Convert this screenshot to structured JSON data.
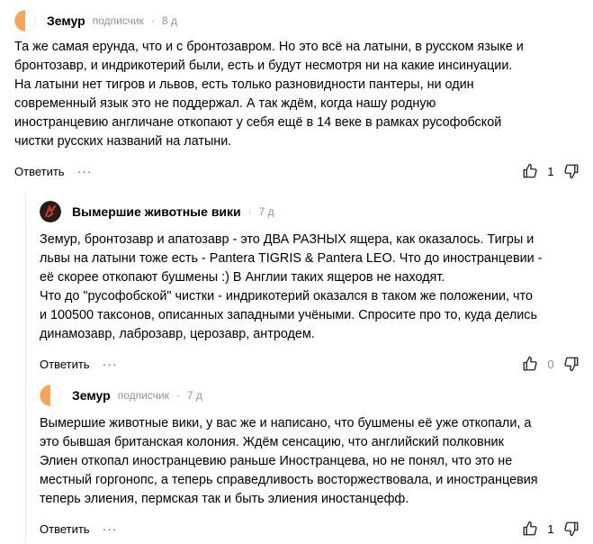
{
  "comments": [
    {
      "author": "Земур",
      "badge": "подписчик",
      "time": "8 д",
      "text": "Та же самая ерунда, что и с бронтозавром. Но это всё на латыни, в русском языке и\nбронтозавр, и индрикотерий были, есть и будут несмотря ни на какие инсинуации.\nНа латыни нет тигров и львов, есть только разновидности пантеры, ни один\nсовременный язык это не поддержал. А так ждём, когда нашу родную\nиностранцевию англичане откопают у себя ещё в 14 веке в рамках русофобской\nчистки русских названий на латыни.",
      "reply_label": "Ответить",
      "more_label": "···",
      "likes": "1"
    },
    {
      "author": "Вымершие животные вики",
      "time": "7 д",
      "text": "Земур, бронтозавр и апатозавр - это ДВА РАЗНЫХ ящера, как оказалось. Тигры и\nльвы на латыни тоже есть - Pantera TIGRIS & Pantera LEO. Что до иностранцевии -\nеё скорее откопают бушмены :) В Англии таких ящеров не находят.\nЧто до \"русофобской\" чистки - индрикотерий оказался в таком же положении, что\nи 100500 таксонов, описанных западными учёными. Спросите про то, куда делись\nдинамозавр, лаброзавр, церозавр, антродем.",
      "reply_label": "Ответить",
      "more_label": "···",
      "likes": "0"
    },
    {
      "author": "Земур",
      "badge": "подписчик",
      "time": "7 д",
      "text": "Вымершие животные вики, у вас же и написано, что бушмены её уже откопали, а\nэто бывшая британская колония. Ждём сенсацию, что английский полковник\nЭлиен откопал иностранцевию раньше Иностранцева, но не понял, что это не\nместный горгонопс, а теперь справедливость восторжествовала, и иностранцевия\nтеперь элиения, пермская так и быть элиения иностанцефф.",
      "reply_label": "Ответить",
      "more_label": "···",
      "likes": "1"
    }
  ],
  "icons": {
    "like": "thumb-up-icon",
    "dislike": "thumb-down-icon",
    "more": "more-dots-icon"
  },
  "colors": {
    "muted": "#8e9298",
    "avatar_orange": "#f2a65a",
    "avatar_dark": "#2b1a1a",
    "avatar_red": "#c0392b"
  }
}
